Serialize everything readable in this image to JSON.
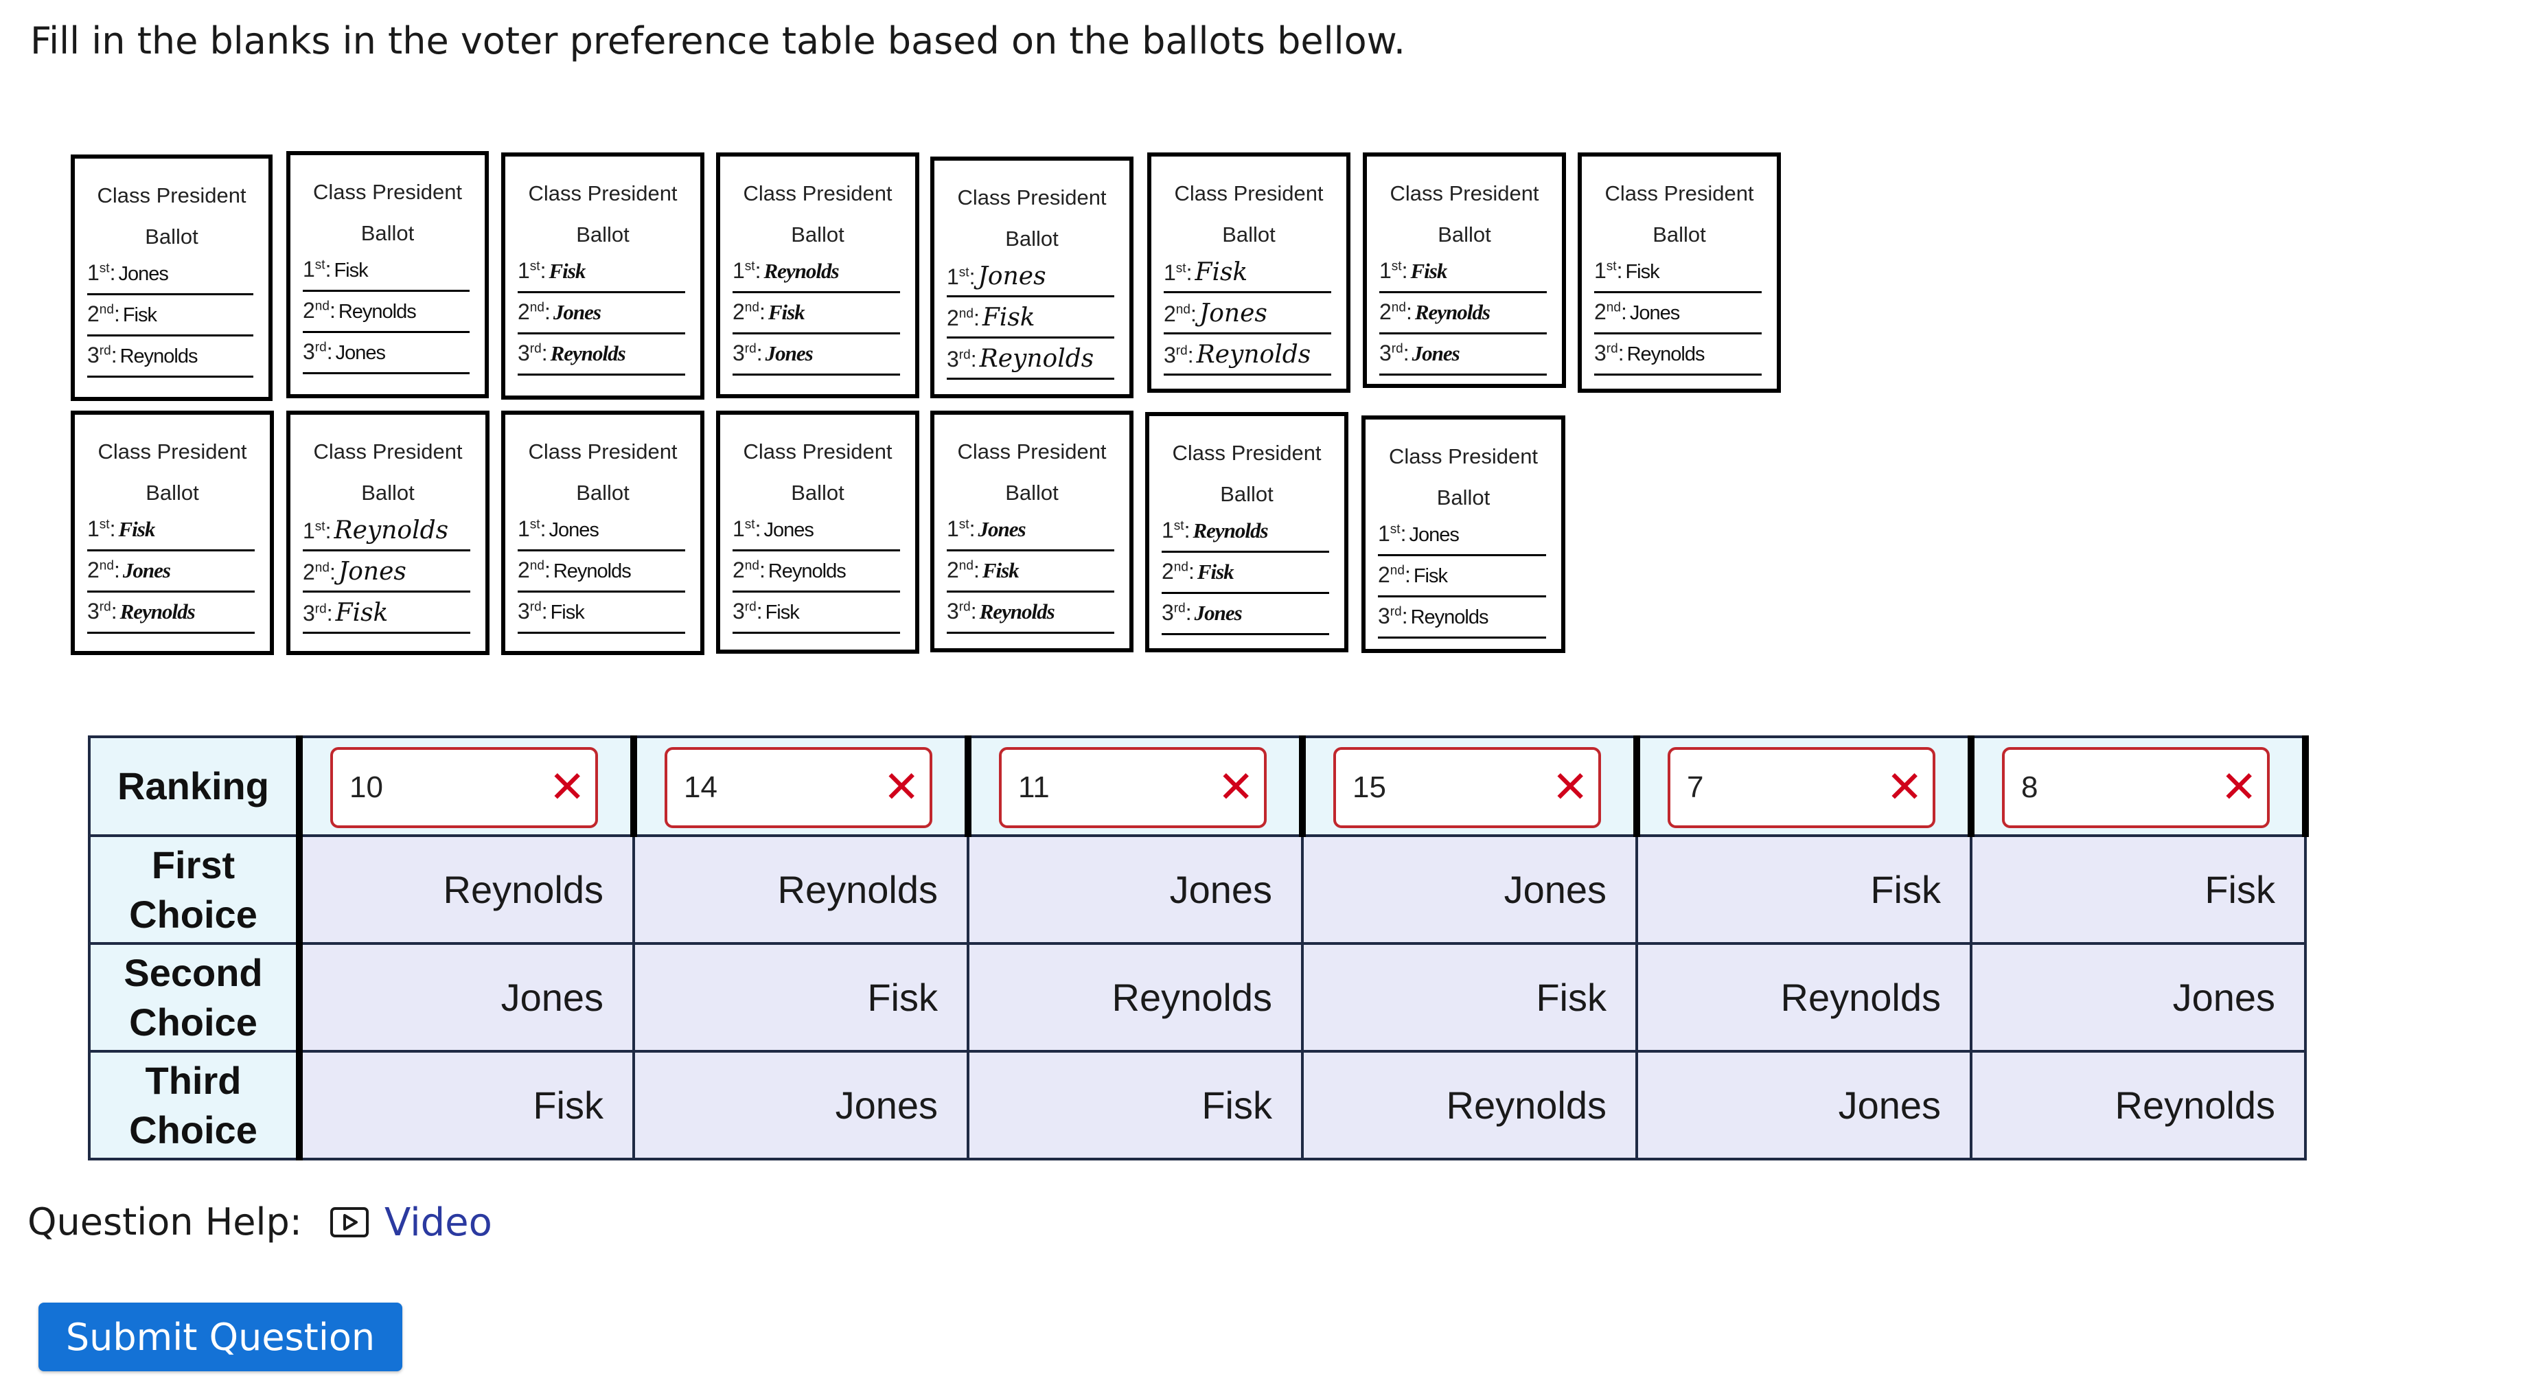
{
  "question": {
    "instruction": "Fill in the blanks in the voter preference table based on the ballots bellow."
  },
  "ballots": [
    {
      "title": "Class President",
      "subtitle": "Ballot",
      "first": "Jones",
      "second": "Fisk",
      "third": "Reynolds"
    },
    {
      "title": "Class President",
      "subtitle": "Ballot",
      "first": "Fisk",
      "second": "Reynolds",
      "third": "Jones"
    },
    {
      "title": "Class President",
      "subtitle": "Ballot",
      "first": "Fisk",
      "second": "Jones",
      "third": "Reynolds"
    },
    {
      "title": "Class President",
      "subtitle": "Ballot",
      "first": "Reynolds",
      "second": "Fisk",
      "third": "Jones"
    },
    {
      "title": "Class President",
      "subtitle": "Ballot",
      "first": "Jones",
      "second": "Fisk",
      "third": "Reynolds"
    },
    {
      "title": "Class President",
      "subtitle": "Ballot",
      "first": "Fisk",
      "second": "Jones",
      "third": "Reynolds"
    },
    {
      "title": "Class President",
      "subtitle": "Ballot",
      "first": "Fisk",
      "second": "Reynolds",
      "third": "Jones"
    },
    {
      "title": "Class President",
      "subtitle": "Ballot",
      "first": "Fisk",
      "second": "Jones",
      "third": "Reynolds"
    },
    {
      "title": "Class President",
      "subtitle": "Ballot",
      "first": "Fisk",
      "second": "Jones",
      "third": "Reynolds"
    },
    {
      "title": "Class President",
      "subtitle": "Ballot",
      "first": "Reynolds",
      "second": "Jones",
      "third": "Fisk"
    },
    {
      "title": "Class President",
      "subtitle": "Ballot",
      "first": "Jones",
      "second": "Reynolds",
      "third": "Fisk"
    },
    {
      "title": "Class President",
      "subtitle": "Ballot",
      "first": "Jones",
      "second": "Reynolds",
      "third": "Fisk"
    },
    {
      "title": "Class President",
      "subtitle": "Ballot",
      "first": "Jones",
      "second": "Fisk",
      "third": "Reynolds"
    },
    {
      "title": "Class President",
      "subtitle": "Ballot",
      "first": "Reynolds",
      "second": "Fisk",
      "third": "Jones"
    },
    {
      "title": "Class President",
      "subtitle": "Ballot",
      "first": "Jones",
      "second": "Fisk",
      "third": "Reynolds"
    }
  ],
  "ordinals": {
    "first": "1",
    "first_sup": "st",
    "second": "2",
    "second_sup": "nd",
    "third": "3",
    "third_sup": "rd"
  },
  "table": {
    "row_headers": {
      "ranking": "Ranking",
      "first_choice": [
        "First",
        "Choice"
      ],
      "second_choice": [
        "Second",
        "Choice"
      ],
      "third_choice": [
        "Third",
        "Choice"
      ]
    },
    "columns": [
      {
        "ranking": "10",
        "first": "Reynolds",
        "second": "Jones",
        "third": "Fisk"
      },
      {
        "ranking": "14",
        "first": "Reynolds",
        "second": "Fisk",
        "third": "Jones"
      },
      {
        "ranking": "11",
        "first": "Jones",
        "second": "Reynolds",
        "third": "Fisk"
      },
      {
        "ranking": "15",
        "first": "Jones",
        "second": "Fisk",
        "third": "Reynolds"
      },
      {
        "ranking": "7",
        "first": "Fisk",
        "second": "Reynolds",
        "third": "Jones"
      },
      {
        "ranking": "8",
        "first": "Fisk",
        "second": "Jones",
        "third": "Reynolds"
      }
    ],
    "incorrect_mark": "✕",
    "incorrect_color": "#d0021b"
  },
  "help": {
    "label": "Question Help:",
    "video_icon": "play-video-icon",
    "video_label": "Video"
  },
  "submit": {
    "label": "Submit Question",
    "color": "#1472d6"
  }
}
